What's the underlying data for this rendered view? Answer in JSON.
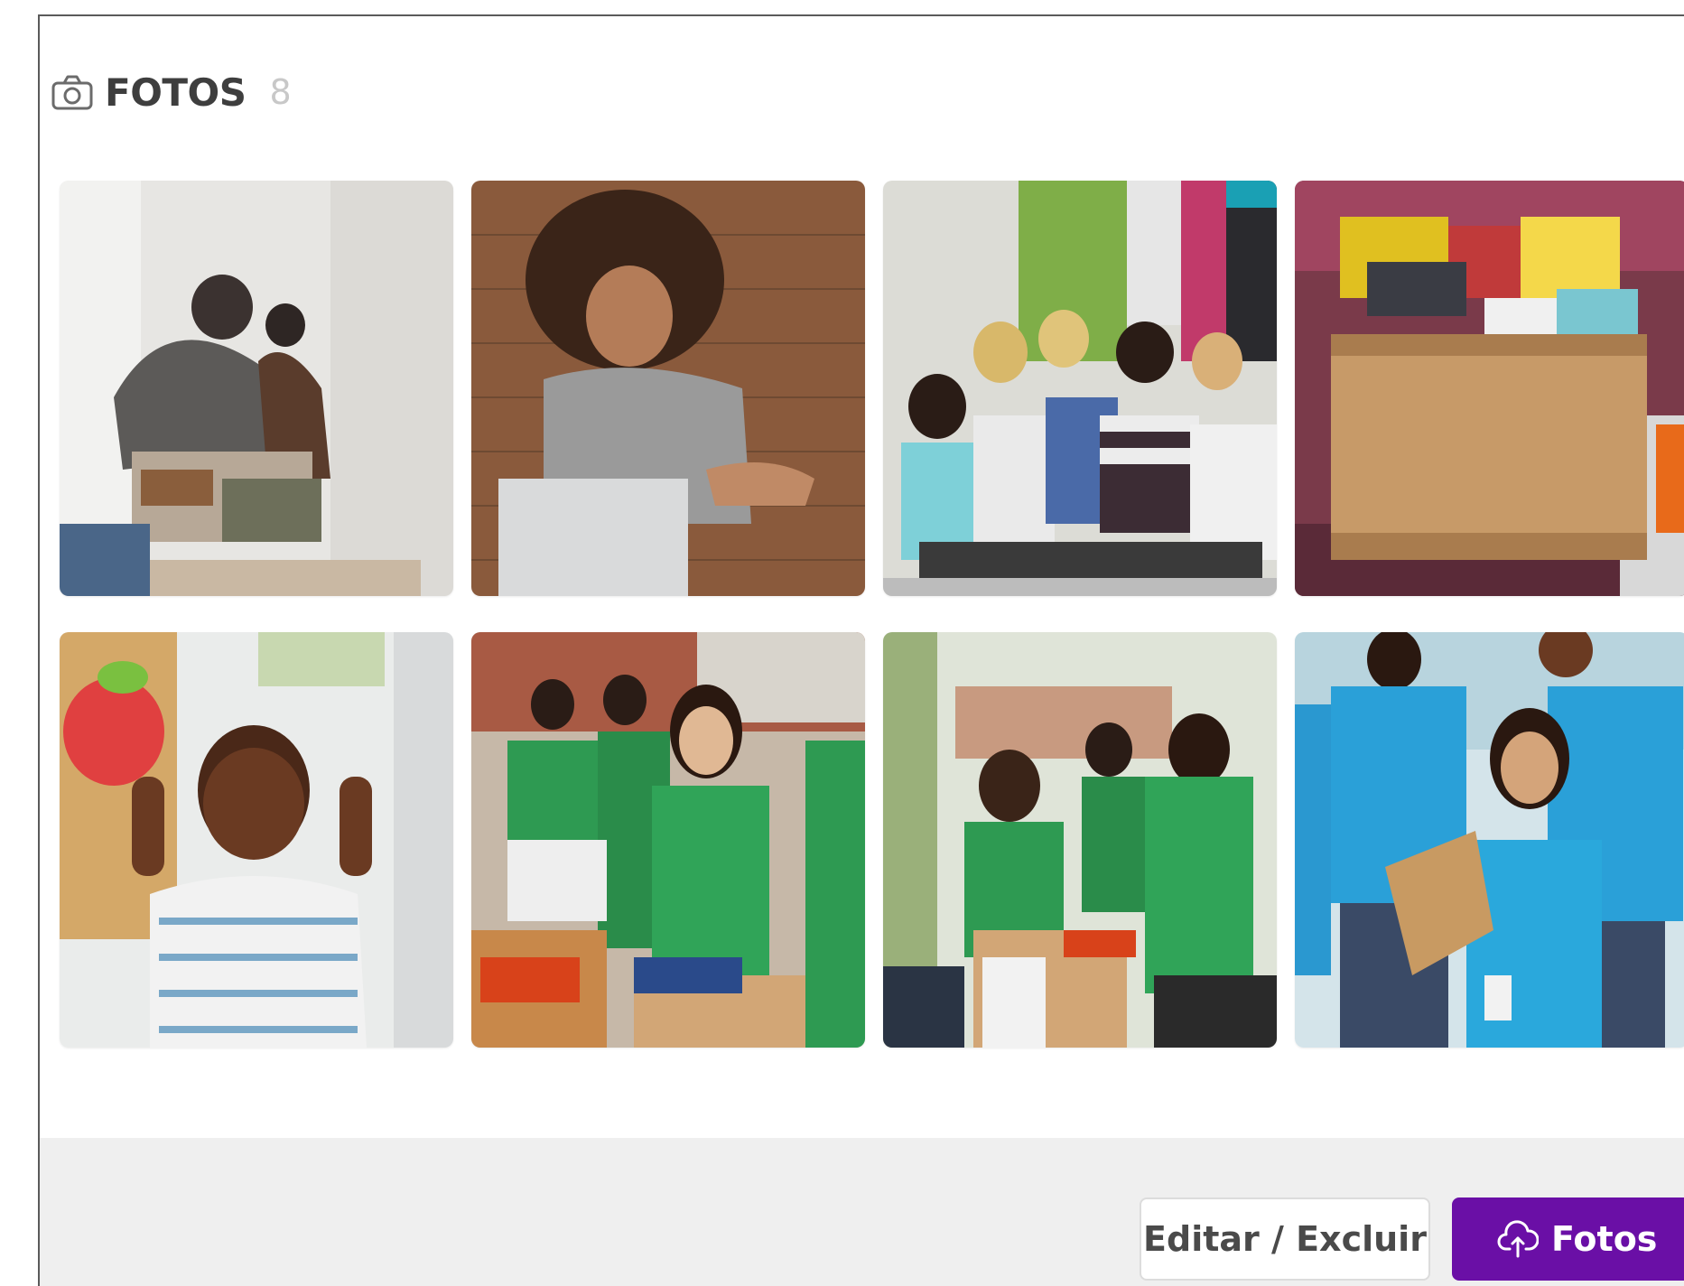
{
  "section": {
    "icon": "camera-icon",
    "title": "FOTOS",
    "count": "8"
  },
  "photos": [
    {
      "name": "photo-family-sorting-clothes",
      "icon": "photo-thumbnail"
    },
    {
      "name": "photo-child-sitting-wall",
      "icon": "photo-thumbnail"
    },
    {
      "name": "photo-children-classroom",
      "icon": "photo-thumbnail"
    },
    {
      "name": "photo-donation-box-supplies",
      "icon": "photo-thumbnail"
    },
    {
      "name": "photo-child-thumbs-up",
      "icon": "photo-thumbnail"
    },
    {
      "name": "photo-volunteers-green-shirts",
      "icon": "photo-thumbnail"
    },
    {
      "name": "photo-volunteers-packing-boxes",
      "icon": "photo-thumbnail"
    },
    {
      "name": "photo-volunteers-blue-shirts",
      "icon": "photo-thumbnail"
    }
  ],
  "footer": {
    "edit_label": "Editar / Excluir",
    "upload_label": "Fotos",
    "upload_icon": "cloud-upload-icon",
    "upload_color": "#6a0fa6"
  }
}
